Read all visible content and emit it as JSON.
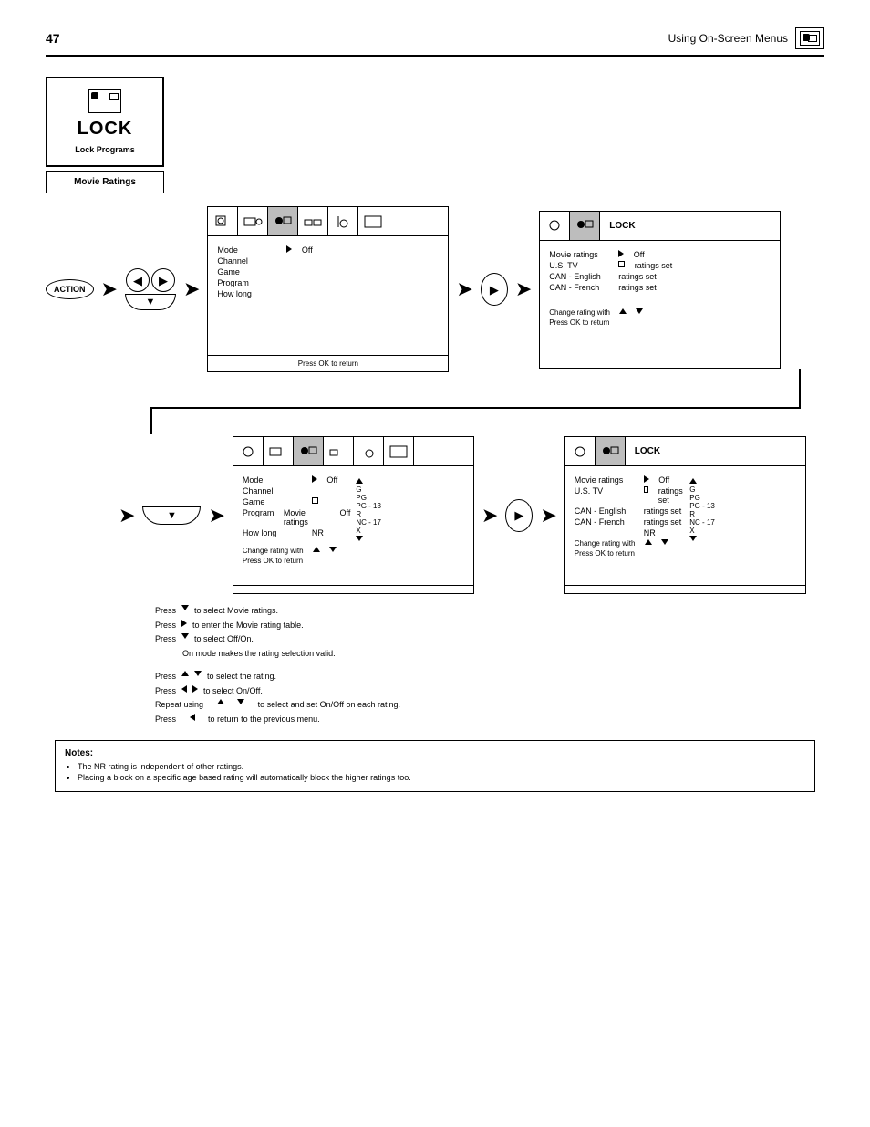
{
  "header": {
    "page_number": "47",
    "breadcrumb": "Using On-Screen Menus"
  },
  "title_box": {
    "main": "LOCK",
    "sub": "Lock Programs"
  },
  "subtitle": "Movie Ratings",
  "btn_action": "ACTION",
  "screens": {
    "s1": {
      "line1_label": "Mode",
      "line1_arrow_after": true,
      "line1_value": "Off",
      "line2": "Channel",
      "line3": "Game",
      "line4": "Program",
      "line5": "How long",
      "footer": "Press OK to return"
    },
    "s2": {
      "tabtitle": "LOCK",
      "l1_label": "Movie ratings",
      "l1_value": "Off",
      "l2_label": "U.S. TV",
      "l2_value": "ratings  set",
      "l3_label": "CAN - English",
      "l3_value": "ratings  set",
      "l4_label": "CAN - French",
      "l4_value": "ratings  set",
      "foot_left": "Change rating with",
      "foot_left2": "Press OK to return"
    },
    "s3": {
      "l1_label": "Mode",
      "l1_value": "Off",
      "l2_label": "Channel",
      "l3_label": "Game",
      "l4_prefix": "Program",
      "l4_label": "Movie ratings",
      "l4_value": "Off",
      "l5_label": "How long",
      "l5_value": "NR",
      "foot_a": "Change rating with",
      "foot_b": "Press OK to return",
      "foot_right_top": "G",
      "foot_right_vals": "PG\nPG - 13\nR\nNC - 17\nX"
    },
    "s4": {
      "tabtitle": "LOCK",
      "l1_label": "Movie ratings",
      "l1_value": "Off",
      "l2_label": "U.S. TV",
      "l2_value": "ratings  set",
      "l3_label": "CAN - English",
      "l3_value": "ratings  set",
      "l4_label": "CAN - French",
      "l4_value": "ratings  set",
      "l5_value": "NR",
      "foot_a": "Change rating with",
      "foot_b": "Press OK to return",
      "foot_r_top": "G",
      "foot_r_vals": "PG\nPG - 13\nR\nNC - 17\nX"
    }
  },
  "instr": {
    "l1": "to select Movie ratings.",
    "l2": "to enter the Movie rating table.",
    "l3": "to select Off/On.",
    "note1": "On mode makes the rating selection valid.",
    "l4": "to select the rating.",
    "l5": "to select On/Off.",
    "l6_a": "Repeat using",
    "l6_b": "to select and set On/Off on each rating.",
    "l7_a": "Press",
    "l7_b": "to return to the previous menu."
  },
  "note": {
    "title": "Notes:",
    "items": [
      "The NR rating is independent of other ratings.",
      "Placing a block on a specific age based rating will automatically block the higher ratings too."
    ]
  },
  "ratings_column": [
    "G",
    "PG",
    "PG - 13",
    "R",
    "NC - 17",
    "X"
  ]
}
